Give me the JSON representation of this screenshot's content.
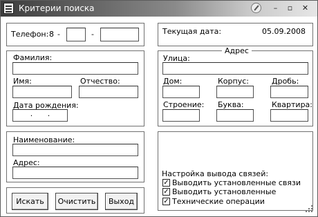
{
  "window": {
    "title": "Критерии поиска",
    "controls": {
      "minimize": "–",
      "maximize": "▫",
      "close": "✕"
    }
  },
  "phone": {
    "label": "Телефон:",
    "prefix": "8",
    "dash1": "-",
    "dash2": "-",
    "code_value": "",
    "number_value": ""
  },
  "date": {
    "label": "Текущая дата:",
    "value": "05.09.2008"
  },
  "person": {
    "surname_label": "Фамилия:",
    "surname_value": "",
    "name_label": "Имя:",
    "name_value": "",
    "patronymic_label": "Отчество:",
    "patronymic_value": "",
    "birthdate_label": "Дата рождения:",
    "birthdate_sep1": "·",
    "birthdate_sep2": "·"
  },
  "address": {
    "legend": "Адрес",
    "street_label": "Улица:",
    "house_label": "Дом:",
    "building_label": "Корпус:",
    "fraction_label": "Дробь:",
    "structure_label": "Строение:",
    "letter_label": "Буква:",
    "apartment_label": "Квартира:"
  },
  "org": {
    "name_label": "Наименование:",
    "address_label": "Адрес:"
  },
  "buttons": {
    "search": "Искать",
    "clear": "Очистить",
    "exit": "Выход"
  },
  "links": {
    "title": "Настройка вывода связей:",
    "options": [
      {
        "label": "Выводить установленные связи",
        "checked": true
      },
      {
        "label": "Выводить установленные",
        "checked": true
      },
      {
        "label": "Технические операции",
        "checked": true
      }
    ]
  }
}
